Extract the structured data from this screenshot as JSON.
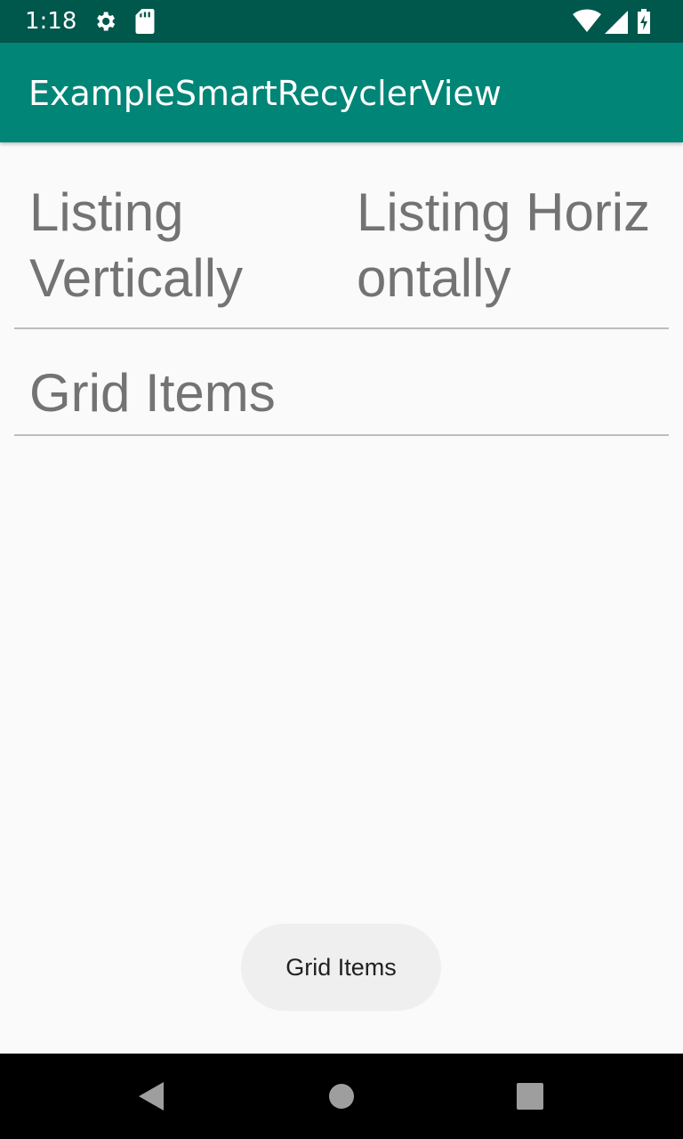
{
  "status_bar": {
    "time": "1:18",
    "left_icons": [
      "settings-icon",
      "sd-card-icon"
    ],
    "right_icons": [
      "wifi-icon",
      "signal-icon",
      "battery-charging-icon"
    ]
  },
  "app_bar": {
    "title": "ExampleSmartRecyclerView"
  },
  "grid": {
    "items": [
      {
        "label": "Listing Vertically"
      },
      {
        "label": "Listing Horizontally"
      },
      {
        "label": "Grid Items"
      }
    ]
  },
  "toast": {
    "message": "Grid Items"
  },
  "nav_bar": {
    "buttons": [
      "back-icon",
      "home-icon",
      "recents-icon"
    ]
  },
  "colors": {
    "status_bar": "#00574b",
    "app_bar": "#008577",
    "background": "#fafafa",
    "item_text": "#737373"
  }
}
